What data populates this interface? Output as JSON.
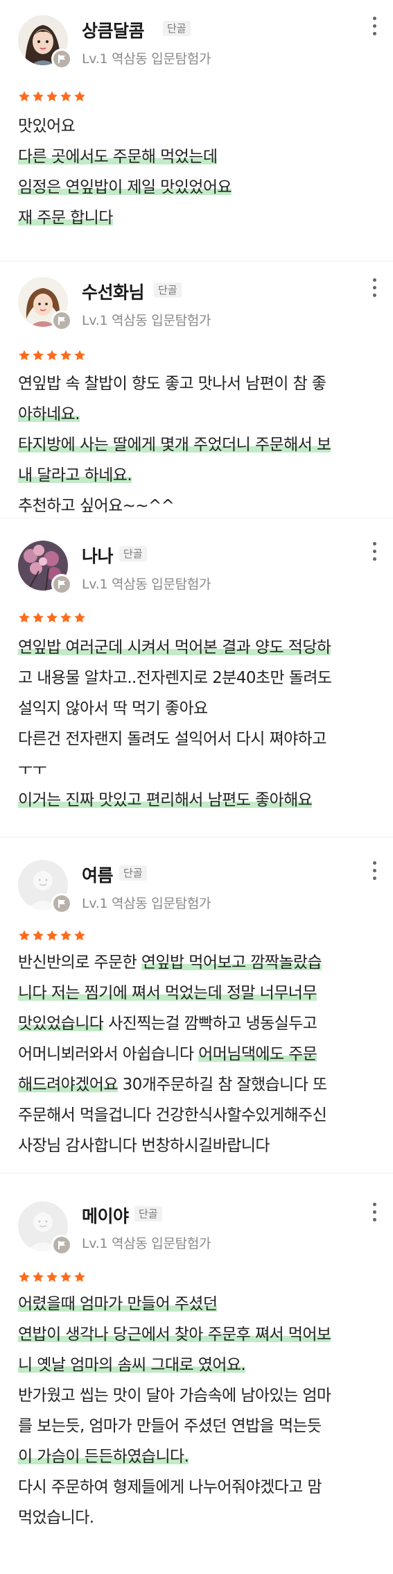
{
  "colors": {
    "star": "#ff6b1a",
    "highlight": "#8fd99a",
    "badge": "#b9b2aa"
  },
  "reviews": [
    {
      "user": "상큼달콤",
      "tag": "단골",
      "level": "Lv.1 역삼동 입문탐험가",
      "rating": 5,
      "lines": [
        {
          "text": "맛있어요",
          "highlight": false
        },
        {
          "text": "다른 곳에서도 주문해 먹었는데",
          "highlight": true
        },
        {
          "text": "임정은 연잎밥이 제일 맛있었어요",
          "highlight": true
        },
        {
          "text": "재 주문 합니다",
          "highlight": true
        }
      ]
    },
    {
      "user": "수선화님",
      "tag": "단골",
      "level": "Lv.1 역삼동 입문탐험가",
      "rating": 5,
      "lines": [
        {
          "text": "연잎밥 속 찰밥이 향도 좋고 맛나서 남편이 참 좋",
          "highlight": false
        },
        {
          "text": "아하네요.",
          "highlight": true
        },
        {
          "text": "타지방에 사는 딸에게 몇개 주었더니 주문해서 보",
          "highlight": true
        },
        {
          "text": "내 달라고 하네요.",
          "highlight": true
        },
        {
          "text": "추천하고 싶어요~~^^",
          "highlight": false
        }
      ]
    },
    {
      "user": "나나",
      "tag": "단골",
      "level": "Lv.1 역삼동 입문탐험가",
      "rating": 5,
      "lines": [
        {
          "text": "연잎밥 여러군데 시켜서 먹어본 결과 양도 적당하",
          "highlight": true
        },
        {
          "text": "고 내용물 알차고..전자렌지로 2분40초만 돌려도",
          "highlight": false
        },
        {
          "text": "설익지 않아서 딱 먹기 좋아요",
          "highlight": false
        },
        {
          "text": "다른건 전자랜지 돌려도 설익어서 다시 쪄야하고",
          "highlight": false
        },
        {
          "text": "ㅜㅜ",
          "highlight": false
        },
        {
          "text": "이거는 진짜 맛있고 편리해서 남편도 좋아해요",
          "highlight": true
        }
      ]
    },
    {
      "user": "여름",
      "tag": "단골",
      "level": "Lv.1 역삼동 입문탐험가",
      "rating": 5,
      "lines": [
        {
          "text": "반신반의로 주문한 연잎밥 먹어보고 깜짝놀랐습",
          "highlight": false
        },
        {
          "text": "니다 저는 찜기에 쪄서 먹었는데 정말 너무너무",
          "highlight": true
        },
        {
          "text": "맛있었습니다 사진찍는걸 깜빡하고 냉동실두고",
          "highlight": false
        },
        {
          "text": "어머니뵈러와서 아쉽습니다 어머님댁에도 주문",
          "highlight": false
        },
        {
          "text": "해드려야겠어요 30개주문하길 참 잘했습니다 또",
          "highlight": false
        },
        {
          "text": "주문해서 먹을겁니다 건강한식사할수있게해주신",
          "highlight": false
        },
        {
          "text": "사장님 감사합니다 번창하시길바랍니다",
          "highlight": false
        }
      ]
    },
    {
      "user": "메이야",
      "tag": "단골",
      "level": "Lv.1 역삼동 입문탐험가",
      "rating": 5,
      "lines": [
        {
          "text": "어렸을때 엄마가 만들어 주셨던",
          "highlight": true
        },
        {
          "text": "연밥이 생각나 당근에서 찾아 주문후 쪄서 먹어보",
          "highlight": true
        },
        {
          "text": "니 옛날 엄마의 솜씨 그대로 였어요.",
          "highlight": true
        },
        {
          "text": "반가웠고 씹는 맛이 달아 가슴속에 남아있는 엄마",
          "highlight": false
        },
        {
          "text": "를 보는듯, 엄마가 만들어 주셨던 연밥을 먹는듯",
          "highlight": false
        },
        {
          "text": "이 가슴이 든든하였습니다.",
          "highlight": true
        },
        {
          "text": "다시 주문하여 형제들에게 나누어줘야겠다고 맘",
          "highlight": false
        },
        {
          "text": "먹었습니다.",
          "highlight": false
        }
      ]
    }
  ]
}
